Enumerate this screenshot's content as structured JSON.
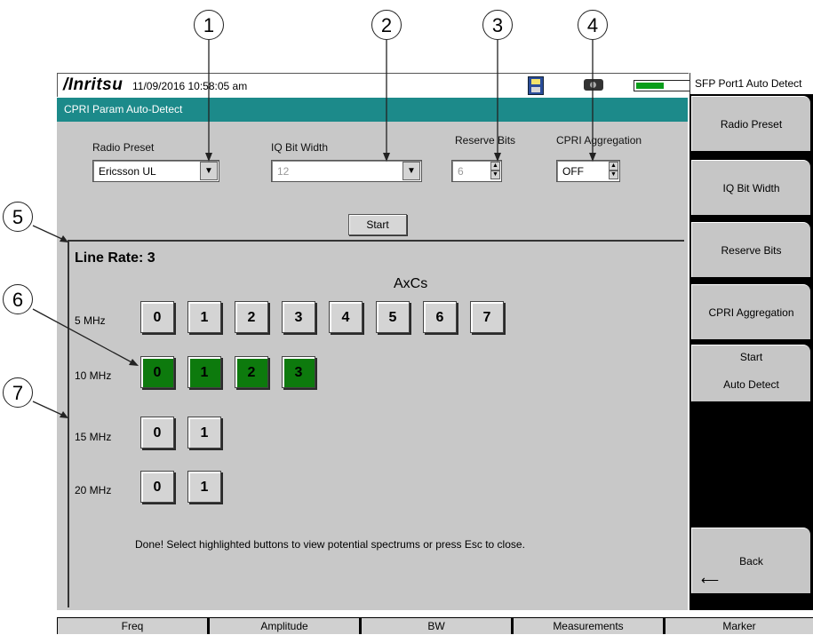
{
  "callouts": [
    "1",
    "2",
    "3",
    "4",
    "5",
    "6",
    "7"
  ],
  "header": {
    "logo": "/Inritsu",
    "datetime": "11/09/2016 10:58:05 am",
    "icons": [
      "save-icon",
      "camera-icon",
      "battery-icon"
    ],
    "battery_level": 0.45
  },
  "window": {
    "title": "CPRI Param Auto-Detect"
  },
  "controls": {
    "radio_preset": {
      "label": "Radio Preset",
      "value": "Ericsson UL"
    },
    "iq_bit_width": {
      "label": "IQ Bit Width",
      "value": "12"
    },
    "reserve_bits": {
      "label": "Reserve Bits",
      "value": "6"
    },
    "cpri_aggregation": {
      "label": "CPRI Aggregation",
      "value": "OFF"
    },
    "start_label": "Start"
  },
  "results": {
    "line_rate": "Line Rate: 3",
    "axcs_label": "AxCs",
    "rows": [
      {
        "label": "5 MHz",
        "buttons": [
          "0",
          "1",
          "2",
          "3",
          "4",
          "5",
          "6",
          "7"
        ],
        "highlighted": false
      },
      {
        "label": "10 MHz",
        "buttons": [
          "0",
          "1",
          "2",
          "3"
        ],
        "highlighted": true
      },
      {
        "label": "15 MHz",
        "buttons": [
          "0",
          "1"
        ],
        "highlighted": false
      },
      {
        "label": "20 MHz",
        "buttons": [
          "0",
          "1"
        ],
        "highlighted": false
      }
    ],
    "status": "Done! Select highlighted buttons to view potential spectrums or press Esc to close."
  },
  "side_menu": {
    "title": "SFP Port1 Auto Detect",
    "keys": [
      "Radio Preset",
      "IQ Bit Width",
      "Reserve Bits",
      "CPRI Aggregation"
    ],
    "start_line1": "Start",
    "start_line2": "Auto Detect",
    "back": "Back"
  },
  "bottom_menu": [
    "Freq",
    "Amplitude",
    "BW",
    "Measurements",
    "Marker"
  ],
  "colors": {
    "title_strip": "#1c8a8a",
    "highlight": "#0d7a0d",
    "panel": "#c8c8c8"
  }
}
